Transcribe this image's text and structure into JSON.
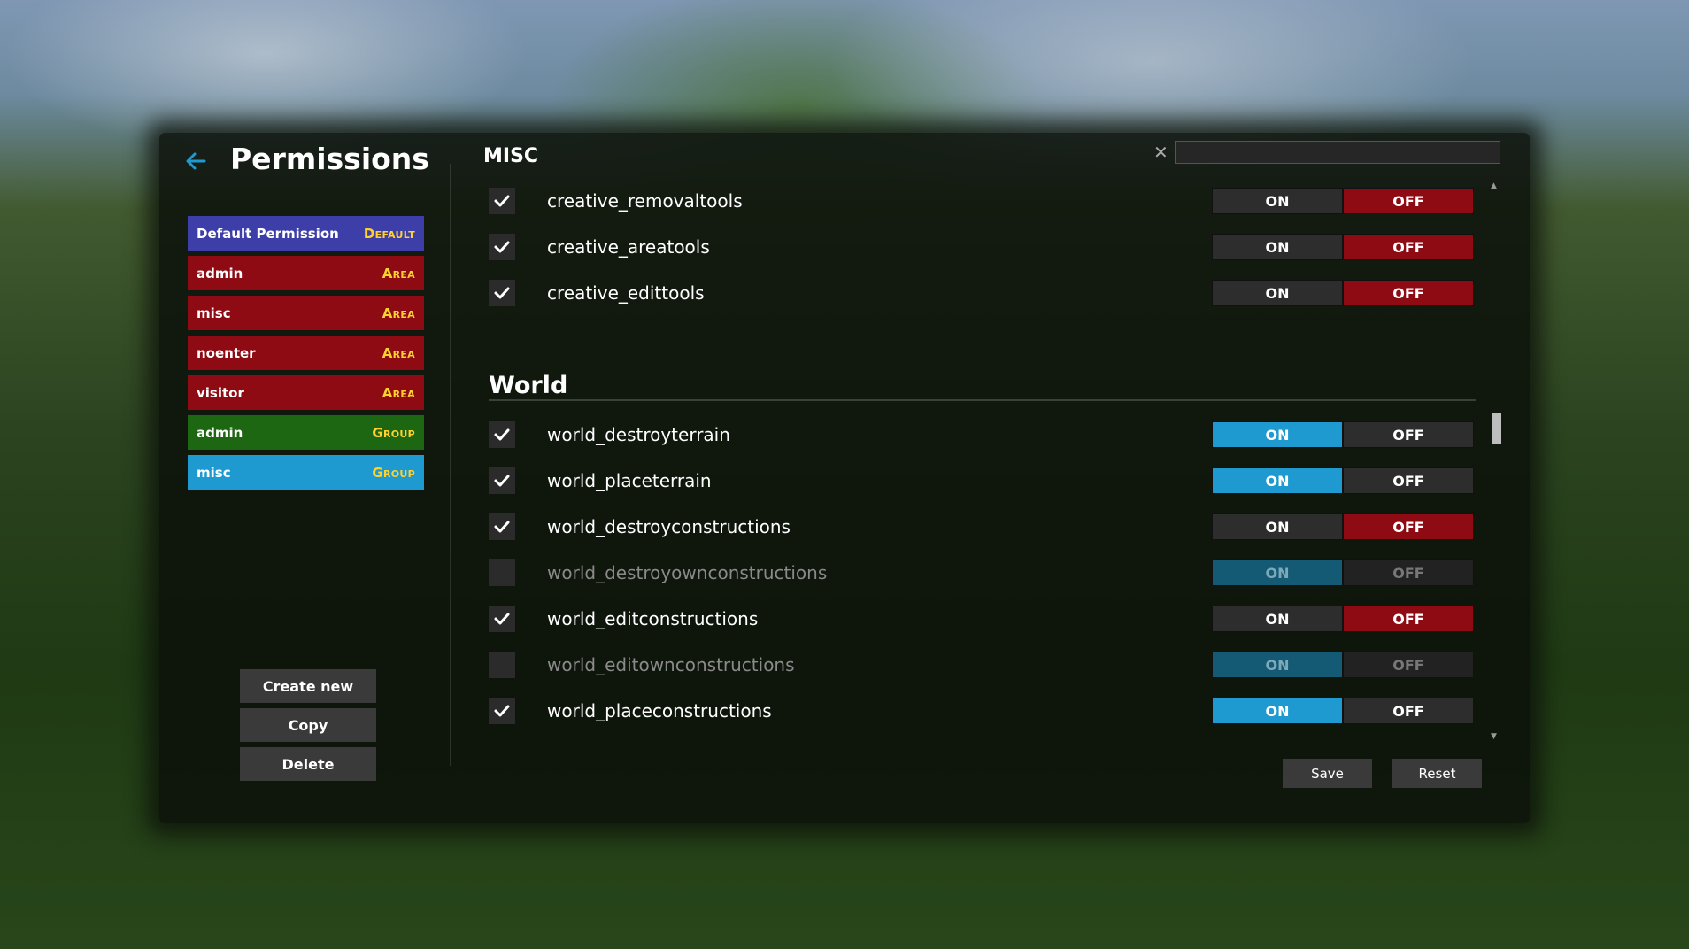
{
  "header": {
    "title": "Permissions",
    "back_icon": "arrow-left-icon"
  },
  "permissions": [
    {
      "name": "Default Permission",
      "type": "Default",
      "color": "#3d3ea8"
    },
    {
      "name": "admin",
      "type": "Area",
      "color": "#8e0b14"
    },
    {
      "name": "misc",
      "type": "Area",
      "color": "#8e0b14"
    },
    {
      "name": "noenter",
      "type": "Area",
      "color": "#8e0b14"
    },
    {
      "name": "visitor",
      "type": "Area",
      "color": "#8e0b14"
    },
    {
      "name": "admin",
      "type": "Group",
      "color": "#1d6612"
    },
    {
      "name": "misc",
      "type": "Group",
      "color": "#1e9ad0"
    }
  ],
  "actions": {
    "create_new": "Create new",
    "copy": "Copy",
    "delete": "Delete"
  },
  "search": {
    "clear_icon": "close-icon",
    "value": ""
  },
  "sections": {
    "misc": {
      "title": "MISC",
      "rows": [
        {
          "label": "creative_removaltools",
          "checked": true,
          "state": "off"
        },
        {
          "label": "creative_areatools",
          "checked": true,
          "state": "off"
        },
        {
          "label": "creative_edittools",
          "checked": true,
          "state": "off"
        }
      ]
    },
    "world": {
      "title": "World",
      "rows": [
        {
          "label": "world_destroyterrain",
          "checked": true,
          "state": "on"
        },
        {
          "label": "world_placeterrain",
          "checked": true,
          "state": "on"
        },
        {
          "label": "world_destroyconstructions",
          "checked": true,
          "state": "off"
        },
        {
          "label": "world_destroyownconstructions",
          "checked": false,
          "state": "on"
        },
        {
          "label": "world_editconstructions",
          "checked": true,
          "state": "off"
        },
        {
          "label": "world_editownconstructions",
          "checked": false,
          "state": "on"
        },
        {
          "label": "world_placeconstructions",
          "checked": true,
          "state": "on"
        }
      ]
    }
  },
  "toggle": {
    "on_label": "ON",
    "off_label": "OFF"
  },
  "footer": {
    "save": "Save",
    "reset": "Reset"
  },
  "colors": {
    "on": "#1e9ad0",
    "off": "#8e0b14",
    "accent": "#ffd230"
  }
}
